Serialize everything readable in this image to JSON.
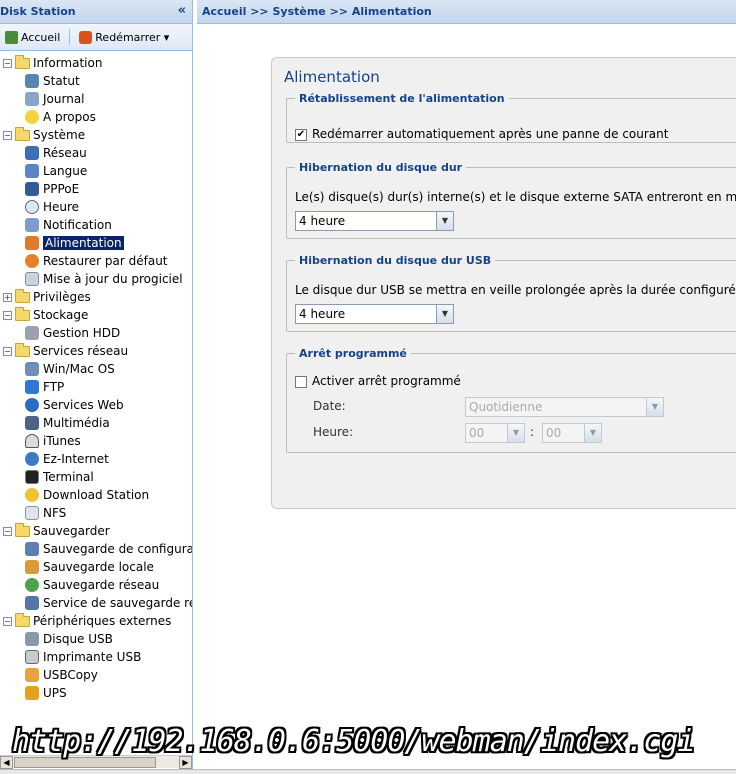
{
  "sidebar": {
    "title": "Disk Station",
    "collapse_glyph": "«",
    "toolbar": {
      "home": "Accueil",
      "restart": "Redémarrer ▾"
    },
    "tree": {
      "information": {
        "label": "Information",
        "toggle": "−",
        "children": [
          "Statut",
          "Journal",
          "A propos"
        ]
      },
      "systeme": {
        "label": "Système",
        "toggle": "−",
        "children": [
          "Réseau",
          "Langue",
          "PPPoE",
          "Heure",
          "Notification",
          "Alimentation",
          "Restaurer par défaut",
          "Mise à jour du progiciel"
        ]
      },
      "privileges": {
        "label": "Privilèges",
        "toggle": "+"
      },
      "stockage": {
        "label": "Stockage",
        "toggle": "−",
        "children": [
          "Gestion HDD"
        ]
      },
      "services": {
        "label": "Services réseau",
        "toggle": "−",
        "children": [
          "Win/Mac OS",
          "FTP",
          "Services Web",
          "Multimédia",
          "iTunes",
          "Ez-Internet",
          "Terminal",
          "Download Station",
          "NFS"
        ]
      },
      "sauvegarder": {
        "label": "Sauvegarder",
        "toggle": "−",
        "children": [
          "Sauvegarde de configuratio",
          "Sauvegarde locale",
          "Sauvegarde réseau",
          "Service de sauvegarde rése"
        ]
      },
      "peripheriques": {
        "label": "Périphériques externes",
        "toggle": "−",
        "children": [
          "Disque USB",
          "Imprimante USB",
          "USBCopy",
          "UPS"
        ]
      }
    }
  },
  "main": {
    "breadcrumb": "Accueil >> Système >> Alimentation",
    "panel_title": "Alimentation",
    "restore": {
      "legend": "Rétablissement de l'alimentation",
      "checkbox_label": "Redémarrer automatiquement après une panne de courant",
      "checked_mark": "✔"
    },
    "hibernation": {
      "legend": "Hibernation du disque dur",
      "text": "Le(s) disque(s) dur(s) interne(s) et le disque externe SATA entreront en mode",
      "value": "4 heure"
    },
    "hibernation_usb": {
      "legend": "Hibernation du disque dur USB",
      "text": "Le disque dur USB se mettra en veille prolongée après la durée configurée.",
      "value": "4 heure"
    },
    "shutdown": {
      "legend": "Arrêt programmé",
      "checkbox_label": "Activer arrêt programmé",
      "date_label": "Date:",
      "date_value": "Quotidienne",
      "time_label": "Heure:",
      "hour_value": "00",
      "separator": ":",
      "minute_value": "00"
    }
  },
  "watermark": "http://192.168.0.6:5000/webman/index.cgi",
  "colors": {
    "accent": "#15428b",
    "selected": "#0a246a",
    "header_bg": "#c2d6ee"
  }
}
